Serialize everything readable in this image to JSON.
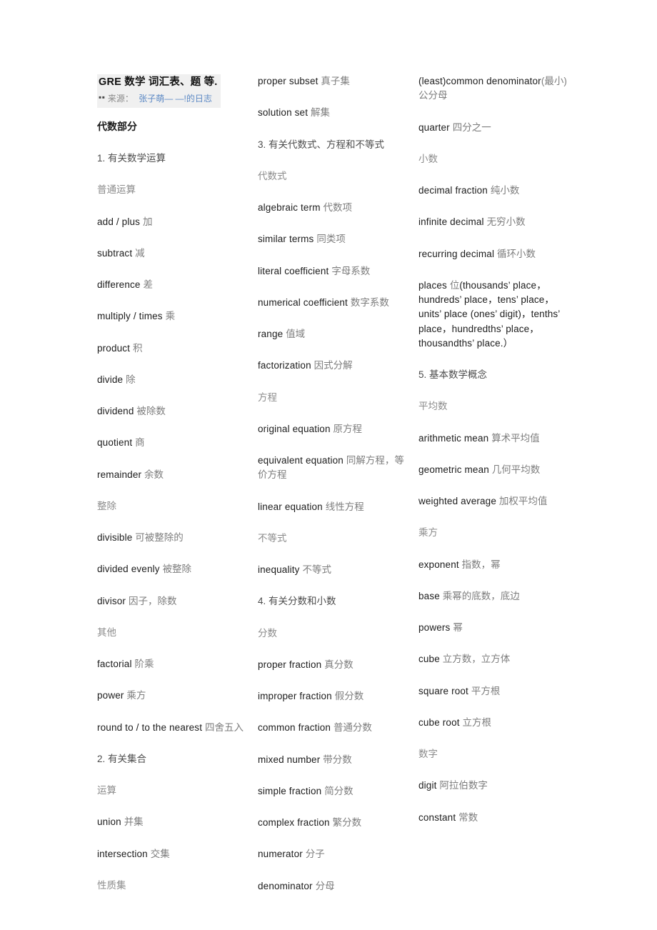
{
  "header": {
    "title": "GRE 数学 词汇表、题 等.",
    "bullets": "▪▪",
    "source_label": "来源：",
    "source_link": "张子萌— —!的日志"
  },
  "columns": [
    {
      "id": "column-1",
      "blocks": [
        {
          "kind": "heading",
          "text": "代数部分"
        },
        {
          "kind": "section",
          "text": "1. 有关数学运算"
        },
        {
          "kind": "sub",
          "text": "普通运算"
        },
        {
          "kind": "term",
          "en": "add / plus ",
          "cn": "加"
        },
        {
          "kind": "term",
          "en": "subtract ",
          "cn": "减"
        },
        {
          "kind": "term",
          "en": "difference ",
          "cn": "差"
        },
        {
          "kind": "term",
          "en": "multiply / times ",
          "cn": "乘"
        },
        {
          "kind": "term",
          "en": "product ",
          "cn": "积"
        },
        {
          "kind": "term",
          "en": "divide ",
          "cn": "除"
        },
        {
          "kind": "term",
          "en": "dividend ",
          "cn": "被除数"
        },
        {
          "kind": "term",
          "en": "quotient ",
          "cn": "商"
        },
        {
          "kind": "term",
          "en": "remainder ",
          "cn": "余数"
        },
        {
          "kind": "sub",
          "text": "整除"
        },
        {
          "kind": "term",
          "en": "divisible ",
          "cn": "可被整除的"
        },
        {
          "kind": "term",
          "en": "divided evenly ",
          "cn": "被整除"
        },
        {
          "kind": "term",
          "en": "divisor ",
          "cn": "因子，除数"
        },
        {
          "kind": "sub",
          "text": "其他"
        },
        {
          "kind": "term",
          "en": "factorial ",
          "cn": "阶乘"
        },
        {
          "kind": "term",
          "en": "power ",
          "cn": "乘方"
        },
        {
          "kind": "term",
          "en": "round to / to the nearest ",
          "cn": "四舍五入"
        },
        {
          "kind": "section",
          "text": "2. 有关集合"
        },
        {
          "kind": "sub",
          "text": "运算"
        },
        {
          "kind": "term",
          "en": "union ",
          "cn": "并集"
        },
        {
          "kind": "term",
          "en": "intersection ",
          "cn": " 交集"
        },
        {
          "kind": "sub",
          "text": "性质集"
        }
      ]
    },
    {
      "id": "column-2",
      "blocks": [
        {
          "kind": "term",
          "en": "proper subset ",
          "cn": "真子集"
        },
        {
          "kind": "term",
          "en": "solution set ",
          "cn": "解集"
        },
        {
          "kind": "section",
          "text": "3. 有关代数式、方程和不等式"
        },
        {
          "kind": "sub",
          "text": "代数式"
        },
        {
          "kind": "term",
          "en": "algebraic term ",
          "cn": " 代数项"
        },
        {
          "kind": "term",
          "en": "similar terms ",
          "cn": "同类项"
        },
        {
          "kind": "term",
          "en": "literal coefficient ",
          "cn": "字母系数"
        },
        {
          "kind": "term",
          "en": "numerical coefficient ",
          "cn": "数字系数"
        },
        {
          "kind": "term",
          "en": "range ",
          "cn": "值域"
        },
        {
          "kind": "term",
          "en": "factorization ",
          "cn": "因式分解"
        },
        {
          "kind": "sub",
          "text": "方程"
        },
        {
          "kind": "term",
          "en": "original equation ",
          "cn": "原方程"
        },
        {
          "kind": "term",
          "en": "equivalent equation ",
          "cn": "同解方程，等价方程"
        },
        {
          "kind": "term",
          "en": "linear equation ",
          "cn": "线性方程"
        },
        {
          "kind": "sub",
          "text": "不等式"
        },
        {
          "kind": "term",
          "en": "inequality ",
          "cn": "不等式"
        },
        {
          "kind": "section",
          "text": "4. 有关分数和小数"
        },
        {
          "kind": "sub",
          "text": "分数"
        },
        {
          "kind": "term",
          "en": "proper fraction ",
          "cn": " 真分数"
        },
        {
          "kind": "term",
          "en": "improper fraction ",
          "cn": "假分数"
        },
        {
          "kind": "term",
          "en": "common fraction ",
          "cn": " 普通分数"
        },
        {
          "kind": "term",
          "en": "mixed number ",
          "cn": "带分数"
        },
        {
          "kind": "term",
          "en": "simple fraction ",
          "cn": "简分数"
        },
        {
          "kind": "term",
          "en": "complex fraction ",
          "cn": "繁分数"
        },
        {
          "kind": "term",
          "en": "numerator ",
          "cn": "分子"
        },
        {
          "kind": "term",
          "en": "denominator ",
          "cn": "分母"
        }
      ]
    },
    {
      "id": "column-3",
      "blocks": [
        {
          "kind": "term",
          "en": "(least)common denominator",
          "cn": "(最小)公分母"
        },
        {
          "kind": "term",
          "en": "quarter ",
          "cn": "四分之一"
        },
        {
          "kind": "sub",
          "text": "小数"
        },
        {
          "kind": "term",
          "en": "decimal fraction ",
          "cn": "纯小数"
        },
        {
          "kind": "term",
          "en": "infinite decimal ",
          "cn": "无穷小数"
        },
        {
          "kind": "term",
          "en": "recurring decimal ",
          "cn": "循环小数"
        },
        {
          "kind": "term",
          "en": "places ",
          "cn": "位",
          "tail": "(thousands’ place，hundreds’ place，tens’ place，units’ place (ones’ digit)，tenths’ place，hundredths’ place，thousandths’ place.）"
        },
        {
          "kind": "section",
          "text": "5. 基本数学概念"
        },
        {
          "kind": "sub",
          "text": "平均数"
        },
        {
          "kind": "term",
          "en": "arithmetic mean ",
          "cn": " 算术平均值"
        },
        {
          "kind": "term",
          "en": "geometric mean ",
          "cn": "几何平均数"
        },
        {
          "kind": "term",
          "en": "weighted average ",
          "cn": "加权平均值"
        },
        {
          "kind": "sub",
          "text": "乘方"
        },
        {
          "kind": "term",
          "en": "exponent ",
          "cn": "指数，幂"
        },
        {
          "kind": "term",
          "en": "base ",
          "cn": "乘幂的底数，底边"
        },
        {
          "kind": "term",
          "en": "powers ",
          "cn": "幂"
        },
        {
          "kind": "term",
          "en": "cube ",
          "cn": "立方数，立方体"
        },
        {
          "kind": "term",
          "en": "square root ",
          "cn": "平方根"
        },
        {
          "kind": "term",
          "en": "cube root ",
          "cn": "立方根"
        },
        {
          "kind": "sub",
          "text": "数字"
        },
        {
          "kind": "term",
          "en": "digit ",
          "cn": "阿拉伯数字"
        },
        {
          "kind": "term",
          "en": "constant ",
          "cn": "常数"
        }
      ]
    }
  ]
}
